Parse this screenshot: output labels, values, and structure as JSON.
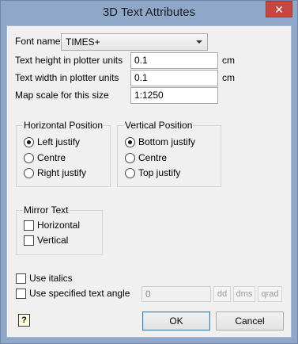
{
  "window": {
    "title": "3D Text Attributes",
    "close_symbol": "✕"
  },
  "font": {
    "label": "Font name",
    "value": "TIMES+"
  },
  "text_height": {
    "label": "Text height in plotter units",
    "value": "0.1",
    "unit": "cm"
  },
  "text_width": {
    "label": "Text width in plotter units",
    "value": "0.1",
    "unit": "cm"
  },
  "map_scale": {
    "label": "Map scale for this size",
    "value": "1:1250"
  },
  "horizontal_position": {
    "title": "Horizontal Position",
    "options": [
      "Left justify",
      "Centre",
      "Right justify"
    ],
    "selected": "Left justify"
  },
  "vertical_position": {
    "title": "Vertical Position",
    "options": [
      "Bottom justify",
      "Centre",
      "Top justify"
    ],
    "selected": "Bottom justify"
  },
  "mirror_text": {
    "title": "Mirror Text",
    "horizontal_label": "Horizontal",
    "vertical_label": "Vertical",
    "horizontal_checked": false,
    "vertical_checked": false
  },
  "use_italics": {
    "label": "Use italics",
    "checked": false
  },
  "use_angle": {
    "label": "Use specified text angle",
    "checked": false,
    "value": "0",
    "units": [
      "dd",
      "dms",
      "qrad"
    ]
  },
  "buttons": {
    "ok": "OK",
    "cancel": "Cancel",
    "help_symbol": "?"
  }
}
